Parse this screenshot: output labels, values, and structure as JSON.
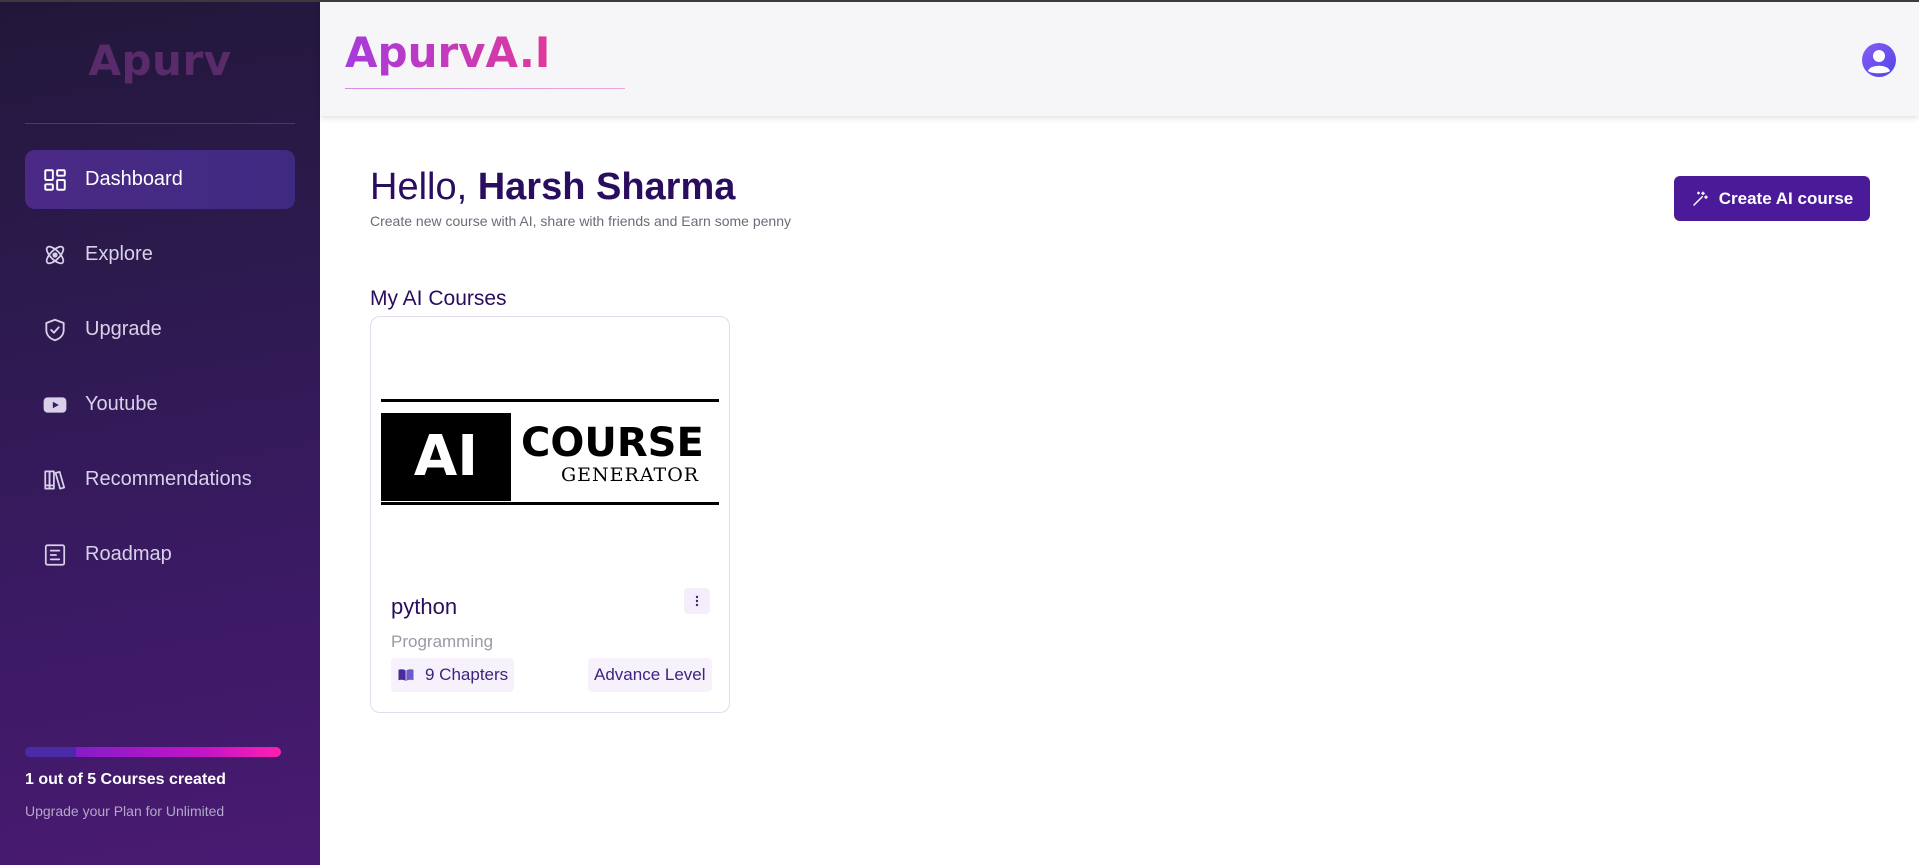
{
  "sidebar": {
    "brand": "Apurv",
    "items": [
      {
        "label": "Dashboard",
        "icon": "dashboard-icon",
        "active": true
      },
      {
        "label": "Explore",
        "icon": "atom-icon",
        "active": false
      },
      {
        "label": "Upgrade",
        "icon": "shield-check-icon",
        "active": false
      },
      {
        "label": "Youtube",
        "icon": "youtube-icon",
        "active": false
      },
      {
        "label": "Recommendations",
        "icon": "library-icon",
        "active": false
      },
      {
        "label": "Roadmap",
        "icon": "document-icon",
        "active": false
      }
    ],
    "progress": {
      "fraction": 0.2,
      "text": "1 out of 5 Courses created",
      "sub": "Upgrade your Plan for Unlimited"
    }
  },
  "header": {
    "logo": "ApurvA.I",
    "avatar_icon": "user-avatar-icon"
  },
  "main": {
    "greeting_prefix": "Hello, ",
    "user_name": "Harsh Sharma",
    "subtitle": "Create new course with AI, share with friends and Earn some penny",
    "create_button": "Create AI course",
    "section_title": "My AI Courses",
    "courses": [
      {
        "title": "python",
        "category": "Programming",
        "chapters": "9 Chapters",
        "level": "Advance Level",
        "image_text_ai": "AI",
        "image_text_course": "COURSE",
        "image_text_generator": "GENERATOR"
      }
    ]
  },
  "colors": {
    "accent": "#4b1a99",
    "text_primary": "#2a0d5e",
    "sidebar_active": "#4b2a86"
  }
}
